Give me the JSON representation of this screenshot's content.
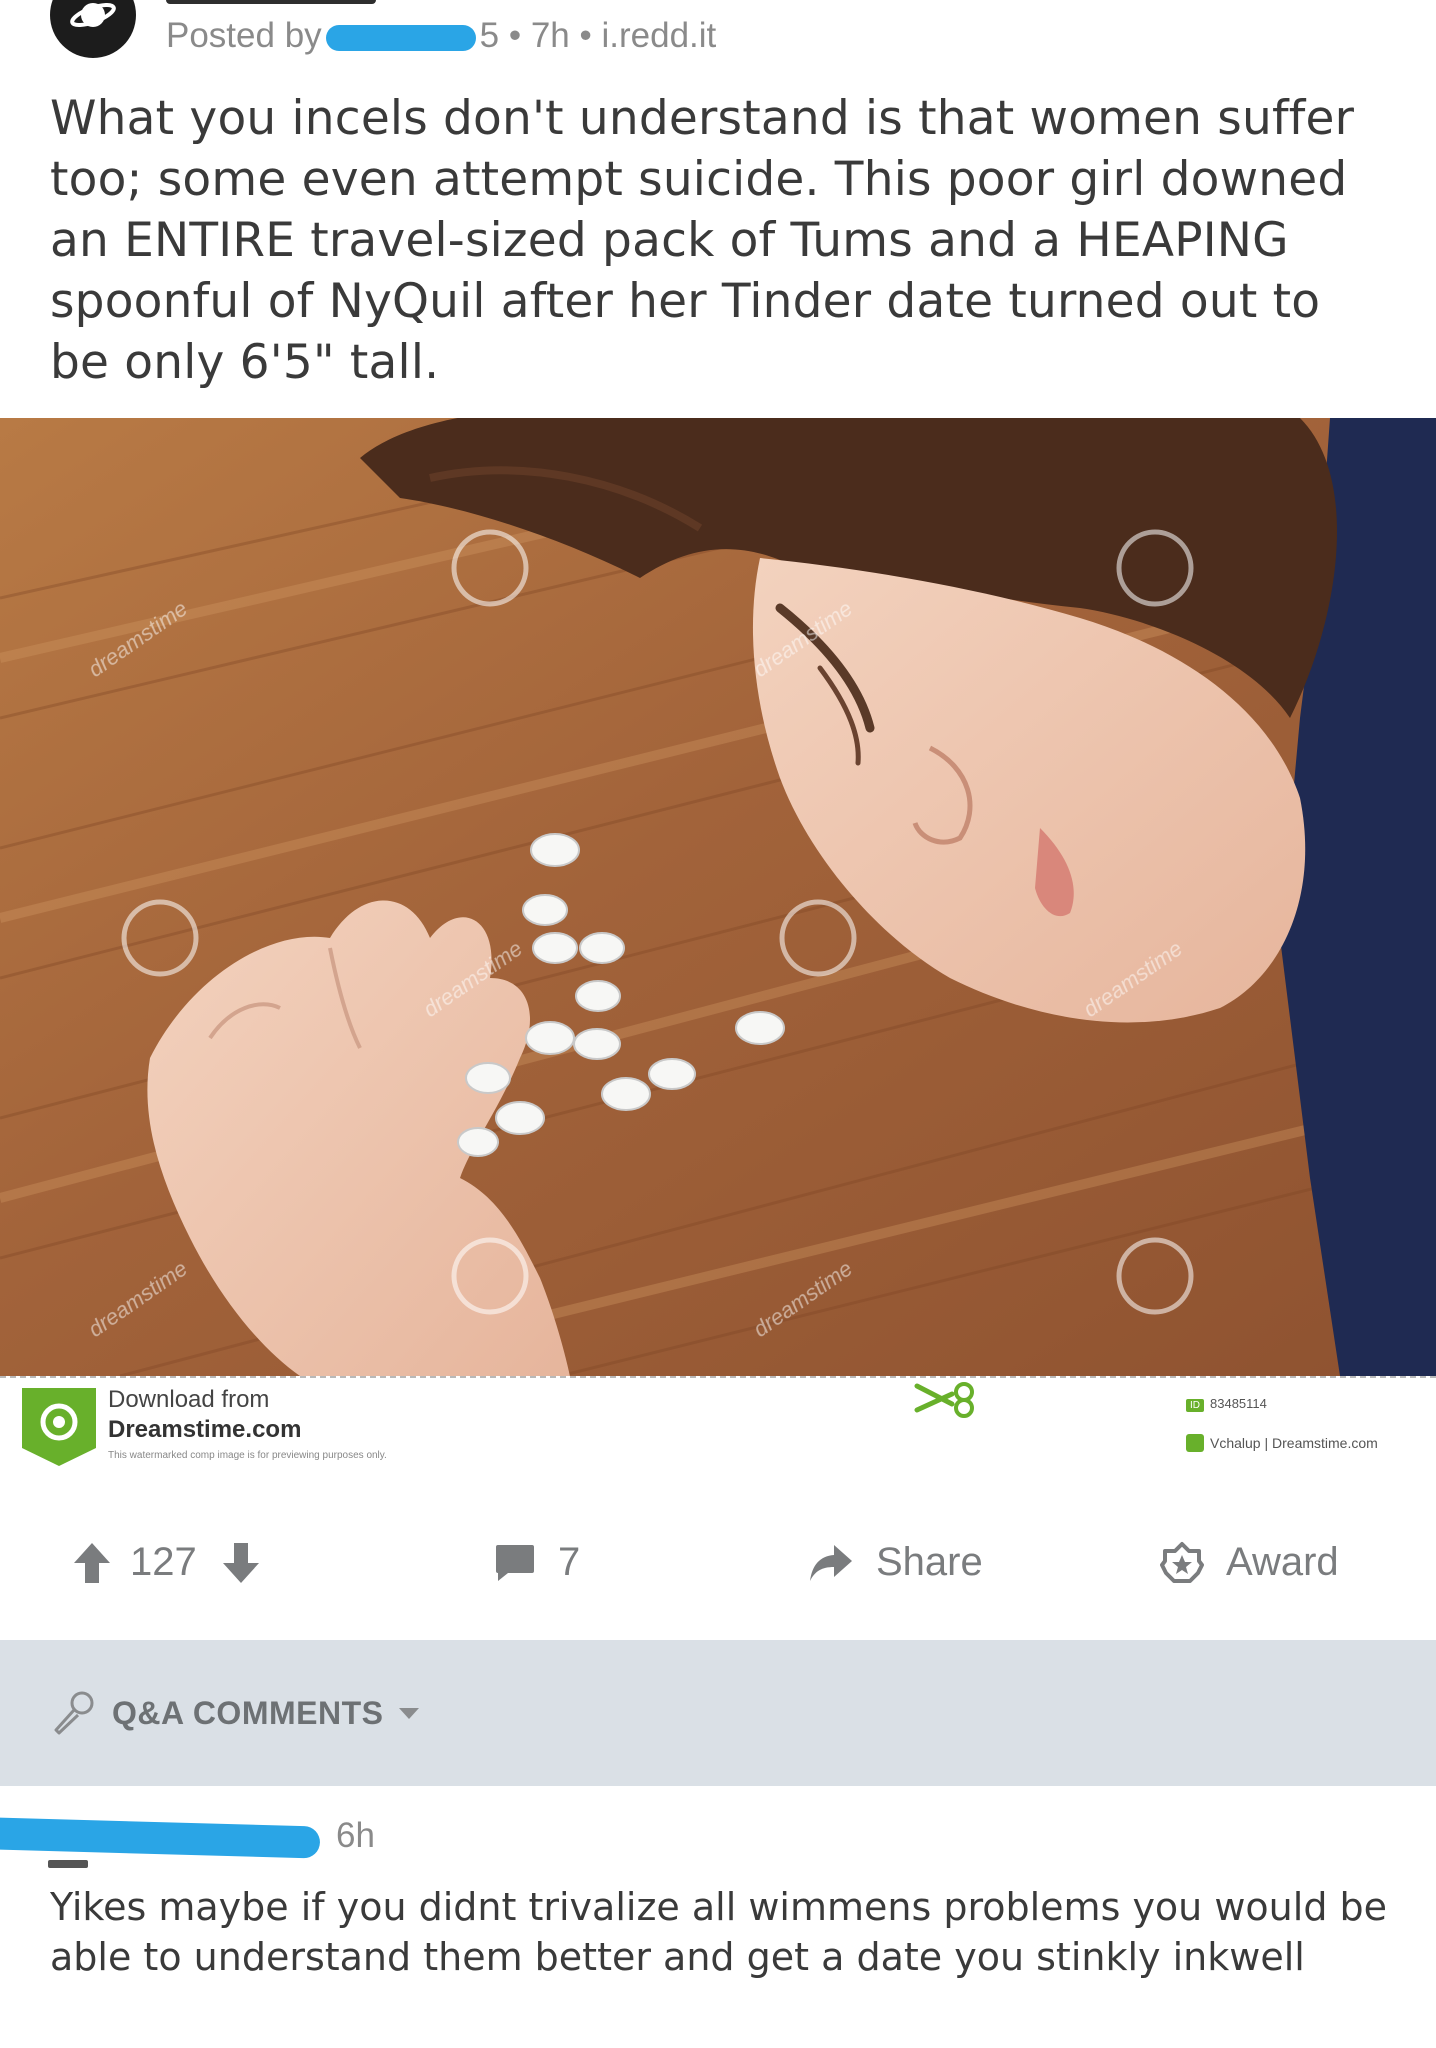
{
  "post": {
    "meta": {
      "posted_by": "Posted by",
      "hidden_tail": "5",
      "age": "• 7h",
      "domain": "• i.redd.it"
    },
    "title": "What you incels don't understand is that women suffer too; some even attempt suicide. This poor girl downed an ENTIRE travel-sized pack of Tums and a HEAPING spoonful of NyQuil after her Tinder date turned out to be only 6'5\" tall.",
    "image": {
      "watermark_text": "dreamstime",
      "footer": {
        "download_label": "Download from",
        "site": "Dreamstime.com",
        "note": "This watermarked comp image is for previewing purposes only.",
        "id_badge": "ID",
        "image_id": "83485114",
        "credit": "Vchalup | Dreamstime.com"
      }
    },
    "actions": {
      "votes": "127",
      "comments": "7",
      "share": "Share",
      "award": "Award"
    }
  },
  "comments_section": {
    "sort_label": "Q&A COMMENTS"
  },
  "comment": {
    "time": "6h",
    "body": "Yikes maybe if you didnt trivalize all wimmens problems you would be able to understand them better and get a date you stinkly inkwell"
  },
  "colors": {
    "text_dark": "#3a3a3a",
    "meta_grey": "#8a8a8a",
    "action_grey": "#7a7c7e",
    "redaction_blue": "#2aa5e6",
    "qa_bar_bg": "#dae0e6",
    "dreamstime_green": "#68b02b"
  },
  "icons": {
    "subreddit": "planet-icon",
    "upvote": "arrow-up-icon",
    "downvote": "arrow-down-icon",
    "comments": "comment-bubble-icon",
    "share": "share-arrow-icon",
    "award": "star-award-icon",
    "qa": "microphone-icon",
    "caret": "chevron-down-icon"
  }
}
